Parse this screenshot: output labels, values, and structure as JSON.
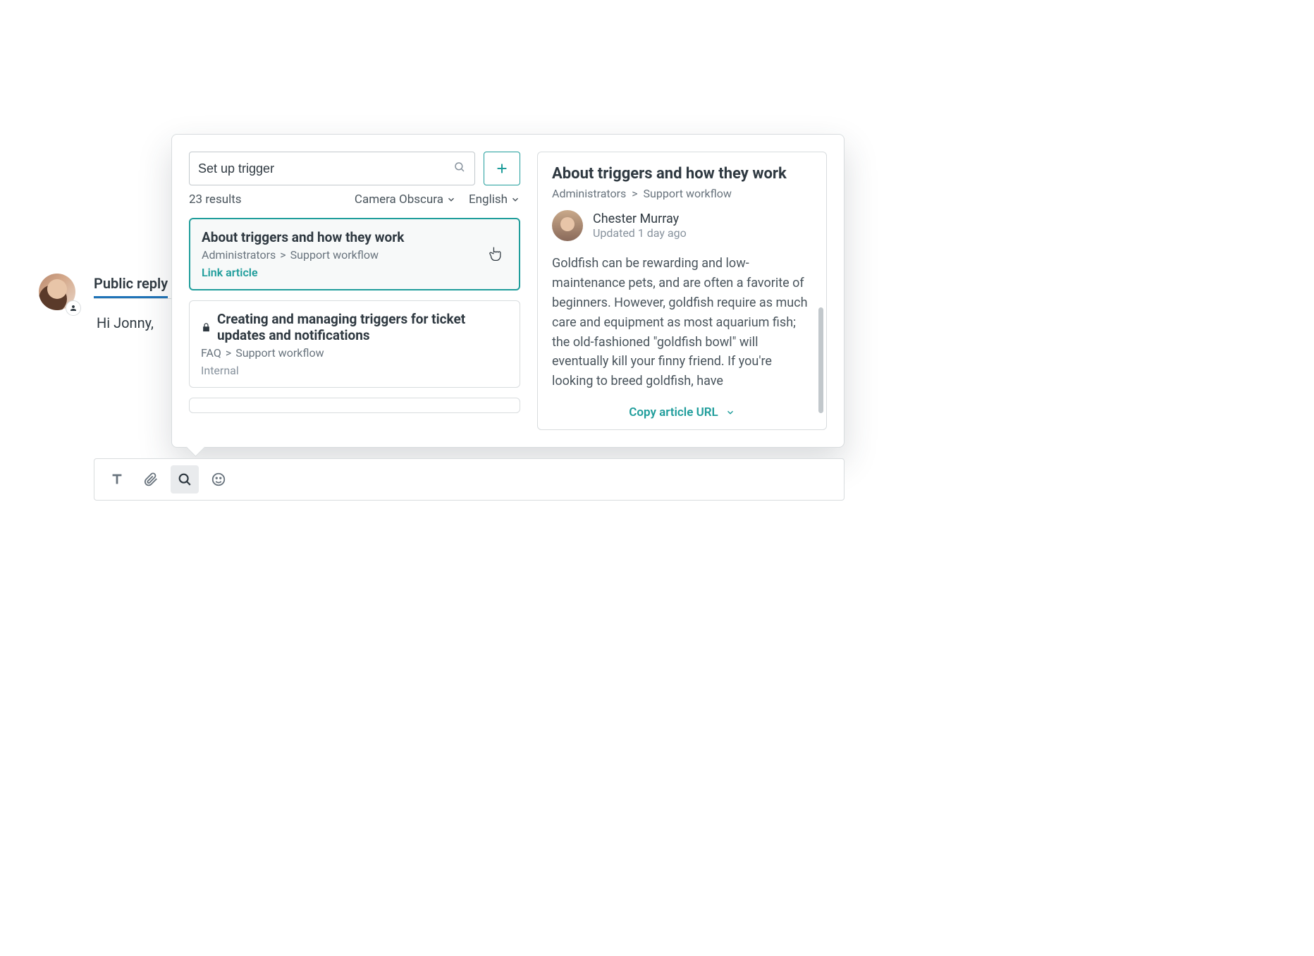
{
  "reply": {
    "tab_label": "Public reply",
    "body_text": "Hi Jonny,"
  },
  "toolbar": {
    "text_icon": "text-format",
    "attach_icon": "attachment",
    "search_icon": "search",
    "emoji_icon": "emoji"
  },
  "search": {
    "query": "Set up trigger",
    "results_count": "23 results",
    "filters": {
      "brand": "Camera Obscura",
      "language": "English"
    },
    "add_button": "+"
  },
  "results": [
    {
      "title": "About triggers and how they work",
      "crumb1": "Administrators",
      "crumb2": "Support workflow",
      "link_label": "Link article",
      "selected": true
    },
    {
      "title": "Creating and managing triggers for ticket updates and notifications",
      "crumb1": "FAQ",
      "crumb2": "Support workflow",
      "internal_label": "Internal",
      "locked": true
    }
  ],
  "preview": {
    "title": "About triggers and how they work",
    "crumb1": "Administrators",
    "crumb2": "Support workflow",
    "author_name": "Chester Murray",
    "updated": "Updated 1 day ago",
    "body": "Goldfish can be rewarding and low-maintenance pets, and are often a favorite of beginners. However, goldfish require as much care and equipment as most aquarium fish; the old-fashioned \"goldfish bowl\" will eventually kill your finny friend. If you're looking to breed goldfish, have",
    "copy_label": "Copy article URL"
  }
}
